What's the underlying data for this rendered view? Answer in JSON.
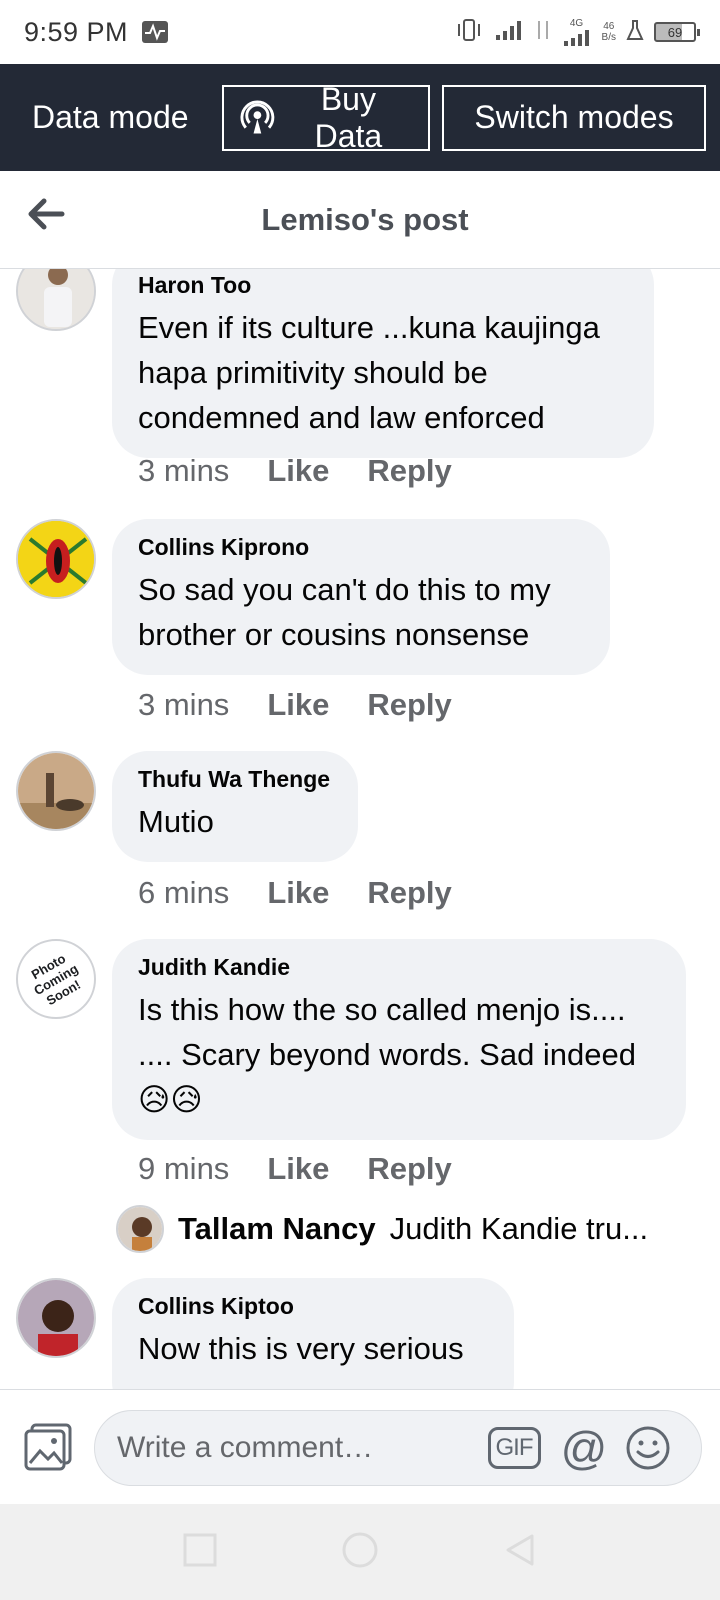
{
  "status": {
    "time": "9:59 PM",
    "net_speed_value": "46",
    "net_speed_unit": "B/s",
    "battery": "69",
    "network": "4G"
  },
  "databar": {
    "label": "Data mode",
    "buy": "Buy Data",
    "switch": "Switch modes"
  },
  "header": {
    "title": "Lemiso's post"
  },
  "comments": [
    {
      "author": "Haron Too",
      "text": "Even if its culture ...kuna kaujinga hapa primitivity should be condemned and law enforced",
      "time": "3 mins",
      "like": "Like",
      "reply": "Reply"
    },
    {
      "author": "Collins Kiprono",
      "text": "So sad you can't  do this to my brother  or cousins  nonsense",
      "time": "3 mins",
      "like": "Like",
      "reply": "Reply"
    },
    {
      "author": "Thufu Wa Thenge",
      "text": "Mutio",
      "time": "6 mins",
      "like": "Like",
      "reply": "Reply"
    },
    {
      "author": "Judith Kandie",
      "text": "Is this how the so called menjo is.... .... Scary beyond words. Sad indeed",
      "emoji": "😥😥",
      "time": "9 mins",
      "like": "Like",
      "reply": "Reply",
      "avatar_text": "Photo Coming Soon!"
    },
    {
      "author": "Collins Kiptoo",
      "text": "Now this is very serious"
    }
  ],
  "reply_preview": {
    "name": "Tallam Nancy",
    "text": "Judith Kandie tru..."
  },
  "composer": {
    "placeholder": "Write a comment…",
    "gif": "GIF",
    "mention": "@"
  },
  "colors": {
    "databar_bg": "#232936",
    "bubble_bg": "#f0f2f5",
    "meta": "#65676b"
  }
}
